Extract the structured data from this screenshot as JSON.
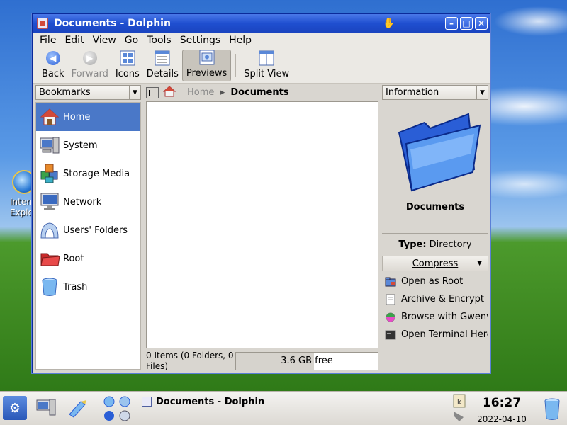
{
  "desktop": {
    "icon_label": "Internet Explorer"
  },
  "window": {
    "title": "Documents - Dolphin",
    "menu": [
      "File",
      "Edit",
      "View",
      "Go",
      "Tools",
      "Settings",
      "Help"
    ],
    "toolbar": {
      "back": "Back",
      "forward": "Forward",
      "icons": "Icons",
      "details": "Details",
      "previews": "Previews",
      "split_view": "Split View"
    },
    "left_panel": {
      "selector": "Bookmarks",
      "places": [
        {
          "label": "Home",
          "icon": "home-icon"
        },
        {
          "label": "System",
          "icon": "computer-icon"
        },
        {
          "label": "Storage Media",
          "icon": "storage-icon"
        },
        {
          "label": "Network",
          "icon": "network-icon"
        },
        {
          "label": "Users' Folders",
          "icon": "users-icon"
        },
        {
          "label": "Root",
          "icon": "root-folder-icon"
        },
        {
          "label": "Trash",
          "icon": "trash-icon"
        }
      ]
    },
    "url": {
      "home": "Home",
      "current": "Documents"
    },
    "status": {
      "items": "0 Items (0 Folders, 0 Files)",
      "free": "3.6 GB free",
      "used_fraction": 0.55
    },
    "right_panel": {
      "selector": "Information",
      "name": "Documents",
      "type_label": "Type:",
      "type_value": "Directory",
      "actions_menu": "Compress",
      "actions": [
        {
          "label": "Open as Root",
          "icon": "folder-root-icon"
        },
        {
          "label": "Archive & Encrypt F",
          "icon": "archive-icon"
        },
        {
          "label": "Browse with Gwenvi",
          "icon": "gwenview-icon"
        },
        {
          "label": "Open Terminal Here",
          "icon": "terminal-icon"
        }
      ]
    }
  },
  "taskbar": {
    "task": "Documents - Dolphin",
    "time": "16:27",
    "date": "2022-04-10"
  },
  "colors": {
    "selection": "#4a78c8",
    "titlebar": "#1f4fd0"
  }
}
